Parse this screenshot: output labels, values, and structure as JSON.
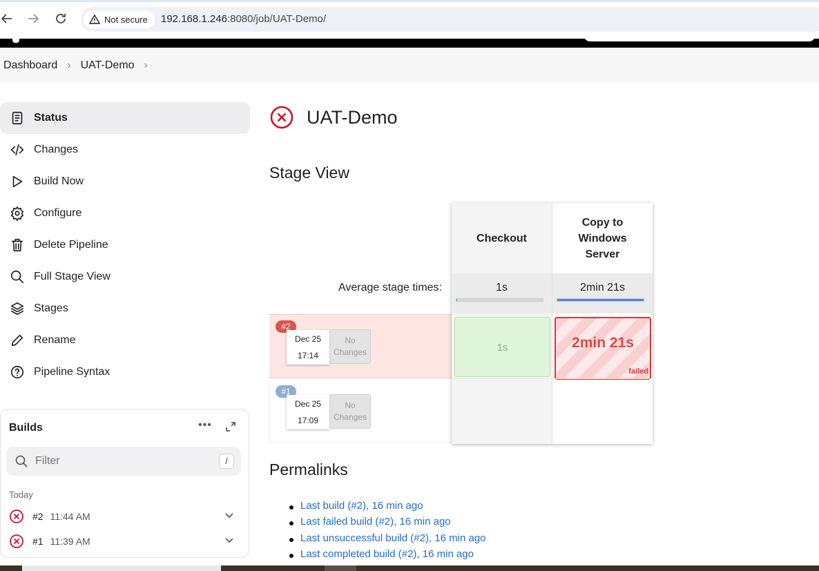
{
  "browser": {
    "security_label": "Not secure",
    "url_host": "192.168.1.246",
    "url_rest": ":8080/job/UAT-Demo/"
  },
  "breadcrumb": [
    "Dashboard",
    "UAT-Demo"
  ],
  "sidebar": {
    "items": [
      {
        "label": "Status",
        "icon": "document-icon"
      },
      {
        "label": "Changes",
        "icon": "code-icon"
      },
      {
        "label": "Build Now",
        "icon": "play-icon"
      },
      {
        "label": "Configure",
        "icon": "gear-icon"
      },
      {
        "label": "Delete Pipeline",
        "icon": "trash-icon"
      },
      {
        "label": "Full Stage View",
        "icon": "search-icon"
      },
      {
        "label": "Stages",
        "icon": "layers-icon"
      },
      {
        "label": "Rename",
        "icon": "pencil-icon"
      },
      {
        "label": "Pipeline Syntax",
        "icon": "help-icon"
      }
    ]
  },
  "builds": {
    "title": "Builds",
    "more": "•••",
    "filter_placeholder": "Filter",
    "filter_shortcut": "/",
    "group_label": "Today",
    "items": [
      {
        "number": "#2",
        "time": "11:44 AM",
        "status": "failed"
      },
      {
        "number": "#1",
        "time": "11:39 AM",
        "status": "failed"
      }
    ]
  },
  "job": {
    "title": "UAT-Demo",
    "status": "failed"
  },
  "stage_view": {
    "title": "Stage View",
    "avg_label": "Average stage times:",
    "stages": [
      {
        "name": "Checkout",
        "avg": "1s",
        "avg_fraction": 0.01
      },
      {
        "name": "Copy to Windows Server",
        "avg": "2min 21s",
        "avg_fraction": 1.0
      }
    ],
    "runs": [
      {
        "badge": "#2",
        "date": "Dec 25",
        "time": "17:14",
        "changes": "No Changes",
        "cells": [
          {
            "text": "1s",
            "status": "success"
          },
          {
            "text": "2min 21s",
            "status": "failed",
            "label": "failed"
          }
        ]
      },
      {
        "badge": "#1",
        "date": "Dec 25",
        "time": "17:09",
        "changes": "No Changes",
        "cells": [
          {
            "text": "",
            "status": "none"
          },
          {
            "text": "",
            "status": "none"
          }
        ]
      }
    ],
    "colors": {
      "failed_badge": "#d9534f",
      "ok_badge": "#8eadd1",
      "failed_row": "#fde6e2"
    }
  },
  "permalinks": {
    "title": "Permalinks",
    "items": [
      "Last build (#2), 16 min ago",
      "Last failed build (#2), 16 min ago",
      "Last unsuccessful build (#2), 16 min ago",
      "Last completed build (#2), 16 min ago"
    ]
  }
}
